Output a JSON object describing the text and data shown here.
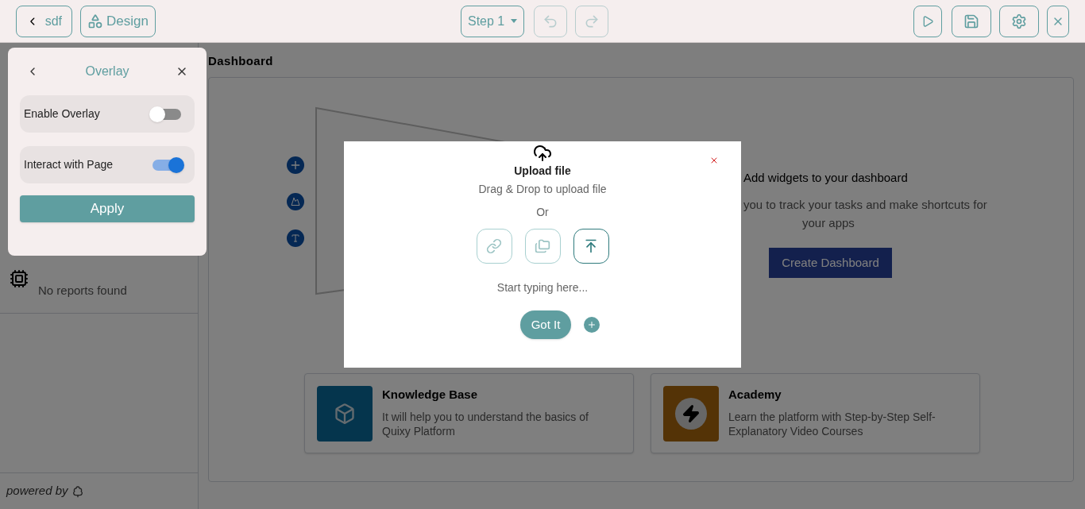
{
  "toolbar": {
    "back_button": "sdf",
    "design_button": "Design",
    "step_select": "Step 1",
    "undo": {
      "disabled": true
    },
    "redo": {
      "disabled": true
    }
  },
  "overlay_panel": {
    "title": "Overlay",
    "toggles": [
      {
        "label": "Enable Overlay",
        "on": false
      },
      {
        "label": "Interact with Page",
        "on": true
      }
    ],
    "apply_button": "Apply"
  },
  "sidebar": {
    "reports_empty": "No reports found",
    "footer": "powered by"
  },
  "main": {
    "title": "Dashboard",
    "empty_state": {
      "heading": "Add widgets to your dashboard",
      "lines": [
        "you to track your tasks and make shortcuts for",
        "your apps"
      ],
      "button": "Create Dashboard"
    },
    "resources": [
      {
        "kind": "knowledge",
        "title": "Knowledge Base",
        "description": "It will help you to understand the basics of Quixy Platform"
      },
      {
        "kind": "academy",
        "title": "Academy",
        "description": "Learn the platform with Step-by-Step Self-Explanatory Video Courses"
      }
    ]
  },
  "modal": {
    "title": "Upload file",
    "subtitle": "Drag & Drop to upload file",
    "separator": "Or",
    "options": [
      {
        "kind": "link",
        "selected": false
      },
      {
        "kind": "folder",
        "selected": false
      },
      {
        "kind": "upload",
        "selected": true
      }
    ],
    "placeholder": "Start typing here...",
    "button": "Got It"
  }
}
